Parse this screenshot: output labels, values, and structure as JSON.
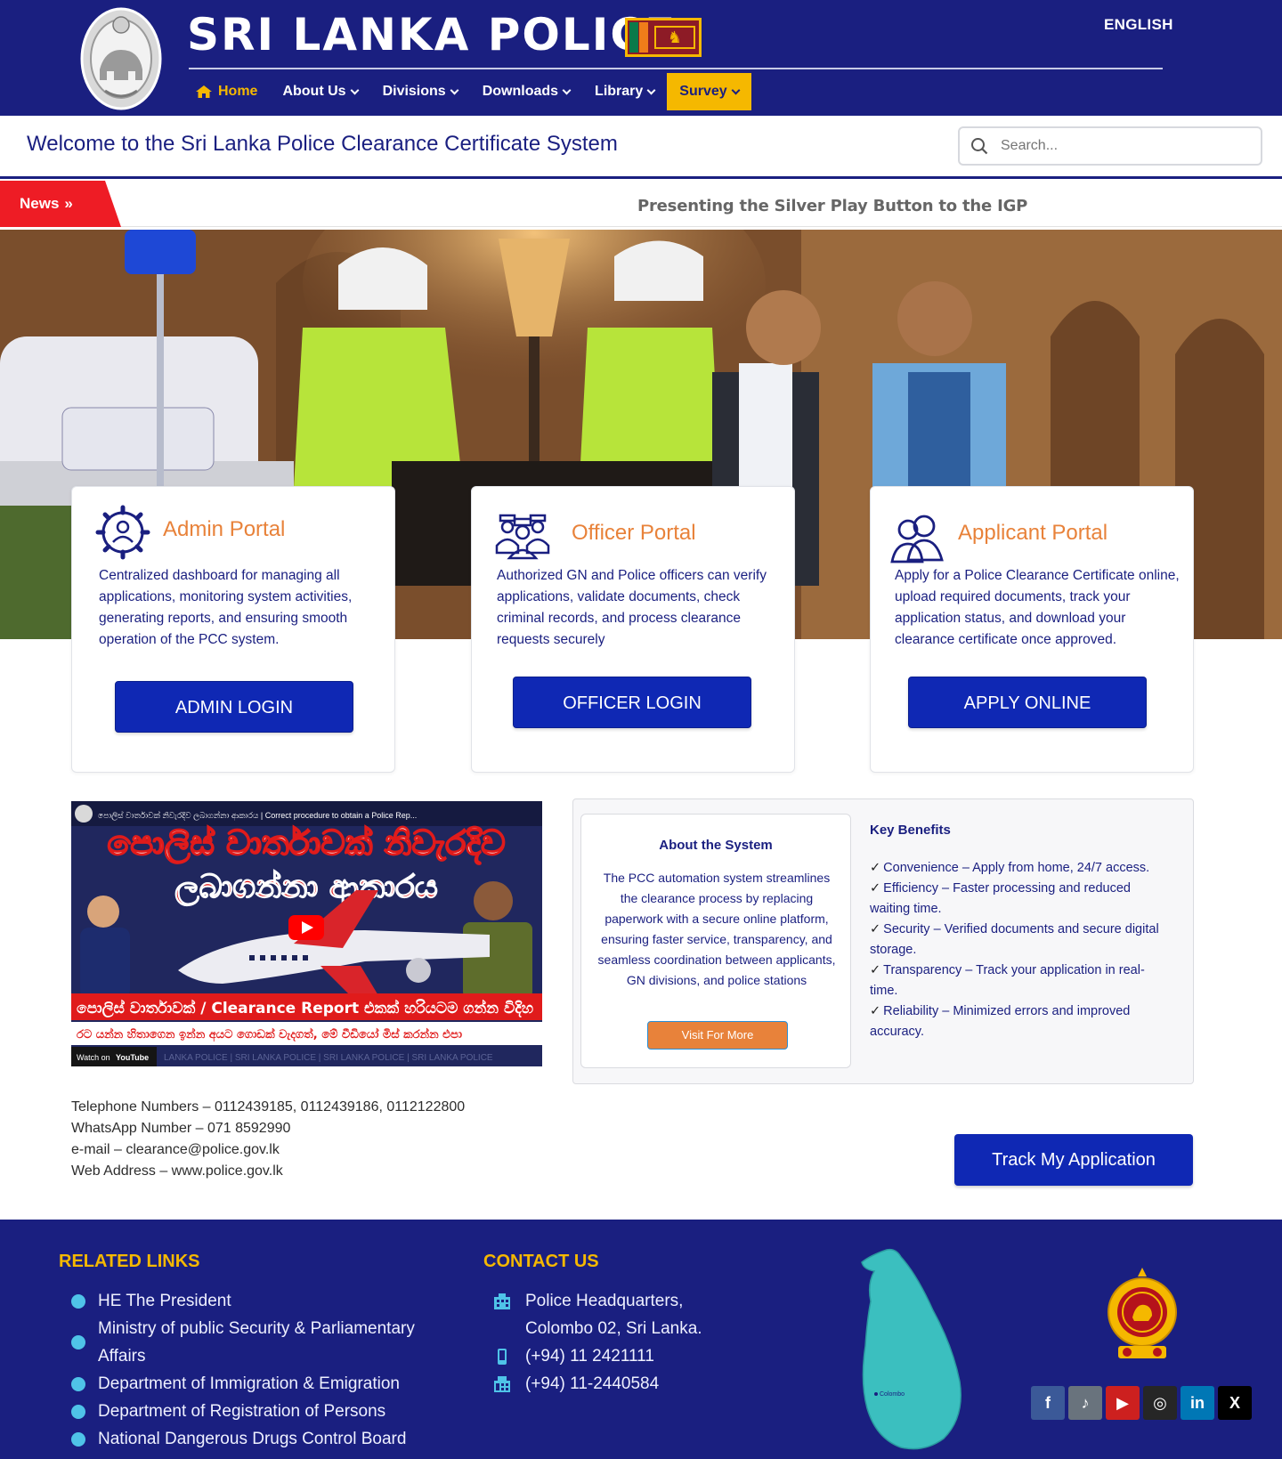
{
  "header": {
    "site_title": "SRI LANKA POLICE",
    "language": "ENGLISH",
    "nav": [
      {
        "label": "Home",
        "icon": "home-icon",
        "has_caret": false
      },
      {
        "label": "About Us",
        "has_caret": true
      },
      {
        "label": "Divisions",
        "has_caret": true
      },
      {
        "label": "Downloads",
        "has_caret": true
      },
      {
        "label": "Library",
        "has_caret": true
      },
      {
        "label": "Survey",
        "has_caret": true
      }
    ]
  },
  "welcome": {
    "title": "Welcome to the Sri Lanka Police Clearance Certificate System",
    "search_placeholder": "Search..."
  },
  "news": {
    "tag": "News",
    "tag_icon": "double-chevron-right-icon",
    "headline": "Presenting the Silver Play Button to the IGP"
  },
  "portals": [
    {
      "title": "Admin Portal",
      "icon": "gear-user-icon",
      "description": "Centralized dashboard for managing all applications, monitoring system activities, generating reports, and ensuring smooth operation of the PCC system.",
      "button": "ADMIN LOGIN"
    },
    {
      "title": "Officer Portal",
      "icon": "officers-group-icon",
      "description": "Authorized GN and Police officers can verify applications, validate documents, check criminal records, and process clearance requests securely",
      "button": "OFFICER LOGIN"
    },
    {
      "title": "Applicant Portal",
      "icon": "users-icon",
      "description": "Apply for a Police Clearance Certificate online, upload required documents, track your application status, and download your clearance certificate once approved.",
      "button": "APPLY ONLINE"
    }
  ],
  "video": {
    "channel_title": "පොලිස් වාර්තාවක් නිවැරදිව ලබාගන්නා ආකාරය | Correct procedure to obtain a Police Rep...",
    "headline_line1": "පොලිස් වාර්තාවක් නිවැරදිව",
    "headline_line2": "ලබාගන්නා ආකාරය",
    "banner": "පොලිස් වාර්තාවක් / Clearance Report එකක් හරියටම ගන්න විදිහ",
    "subbanner": "රට යන්න හිතාගෙන ඉන්න අයට ගොඩක් වැදගත්, මේ වීඩියෝ මිස් කරන්න එපා",
    "watch_on": "Watch on",
    "youtube": "YouTube",
    "footer_strip": "LANKA POLICE | SRI LANKA POLICE | SRI LANKA POLICE | SRI LANKA POLICE"
  },
  "about": {
    "title": "About the System",
    "text": "The PCC automation system streamlines the clearance process by replacing paperwork with a secure online platform, ensuring faster service, transparency, and seamless coordination between applicants, GN divisions, and police stations",
    "button": "Visit For More"
  },
  "benefits": {
    "title": "Key Benefits",
    "items": [
      "Convenience – Apply from home, 24/7 access.",
      "Efficiency – Faster processing and reduced waiting time.",
      "Security – Verified documents and secure digital storage.",
      "Transparency – Track your application in real-time.",
      "Reliability – Minimized errors and improved accuracy."
    ]
  },
  "contact_info": [
    "Telephone Numbers – 0112439185, 0112439186, 0112122800",
    "WhatsApp Number – 071 8592990",
    "e-mail – clearance@police.gov.lk",
    "Web Address – www.police.gov.lk"
  ],
  "track_button": "Track My Application",
  "footer": {
    "related_title": "RELATED LINKS",
    "related_links": [
      "HE The President",
      "Ministry of public Security & Parliamentary Affairs",
      "Department of Immigration & Emigration",
      "Department of Registration of Persons",
      "National Dangerous Drugs Control Board"
    ],
    "contact_title": "CONTACT US",
    "contact_rows": [
      {
        "icon": "building-icon",
        "text": "Police Headquarters,"
      },
      {
        "icon": "",
        "text": "Colombo 02, Sri Lanka."
      },
      {
        "icon": "mobile-phone-icon",
        "text": "(+94) 11 2421111"
      },
      {
        "icon": "fax-icon",
        "text": "(+94) 11-2440584"
      }
    ],
    "map_label": "Colombo",
    "socials": [
      {
        "name": "facebook",
        "glyph": "f",
        "color": "#3b5998"
      },
      {
        "name": "tiktok",
        "glyph": "♪",
        "color": "#69737d"
      },
      {
        "name": "youtube",
        "glyph": "▶",
        "color": "#cd201f"
      },
      {
        "name": "instagram",
        "glyph": "◎",
        "color": "#262626"
      },
      {
        "name": "linkedin",
        "glyph": "in",
        "color": "#0077b5"
      },
      {
        "name": "x",
        "glyph": "X",
        "color": "#000000"
      }
    ]
  },
  "colors": {
    "primary_navy": "#1a1f80",
    "accent_yellow": "#f5b800",
    "accent_orange": "#e8823a",
    "button_blue": "#0f28b4",
    "news_red": "#ee1c25",
    "footer_bullet": "#4fc3e8"
  }
}
